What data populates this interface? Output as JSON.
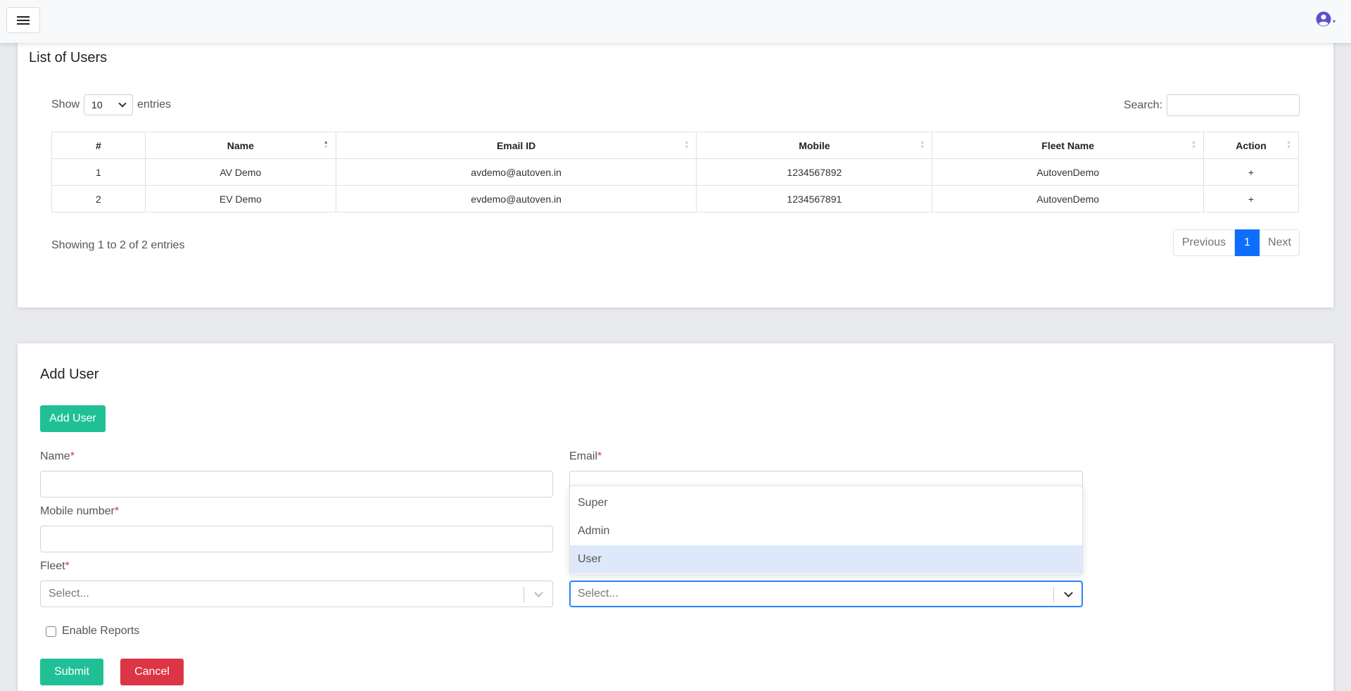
{
  "navbar": {
    "menu_icon": "hamburger-icon",
    "user_icon": "user-circle-icon",
    "user_caret": "▾"
  },
  "users_list": {
    "title": "List of Users",
    "show_label": "Show",
    "entries_label": "entries",
    "page_length": "10",
    "search_label": "Search:",
    "search_value": "",
    "columns": [
      "#",
      "Name",
      "Email ID",
      "Mobile",
      "Fleet Name",
      "Action"
    ],
    "rows": [
      {
        "num": "1",
        "name": "AV Demo",
        "email": "avdemo@autoven.in",
        "mobile": "1234567892",
        "fleet": "AutovenDemo",
        "action": "+"
      },
      {
        "num": "2",
        "name": "EV Demo",
        "email": "evdemo@autoven.in",
        "mobile": "1234567891",
        "fleet": "AutovenDemo",
        "action": "+"
      }
    ],
    "info": "Showing 1 to 2 of 2 entries",
    "pagination": {
      "previous": "Previous",
      "current": "1",
      "next": "Next"
    }
  },
  "add_user": {
    "title": "Add User",
    "add_button": "Add User",
    "name_label": "Name",
    "email_label": "Email",
    "mobile_label": "Mobile number",
    "fleet_label": "Fleet",
    "required_mark": "*",
    "fleet_placeholder": "Select...",
    "role_placeholder": "Select...",
    "role_options": [
      "Super",
      "Admin",
      "User"
    ],
    "role_highlighted": "User",
    "enable_reports_label": "Enable Reports",
    "submit": "Submit",
    "cancel": "Cancel"
  },
  "colors": {
    "accent_green": "#20c096",
    "cancel_red": "#dc3545",
    "page_active_blue": "#0d6efd",
    "focus_border": "#2684ff",
    "option_highlight": "#dde9fb"
  }
}
